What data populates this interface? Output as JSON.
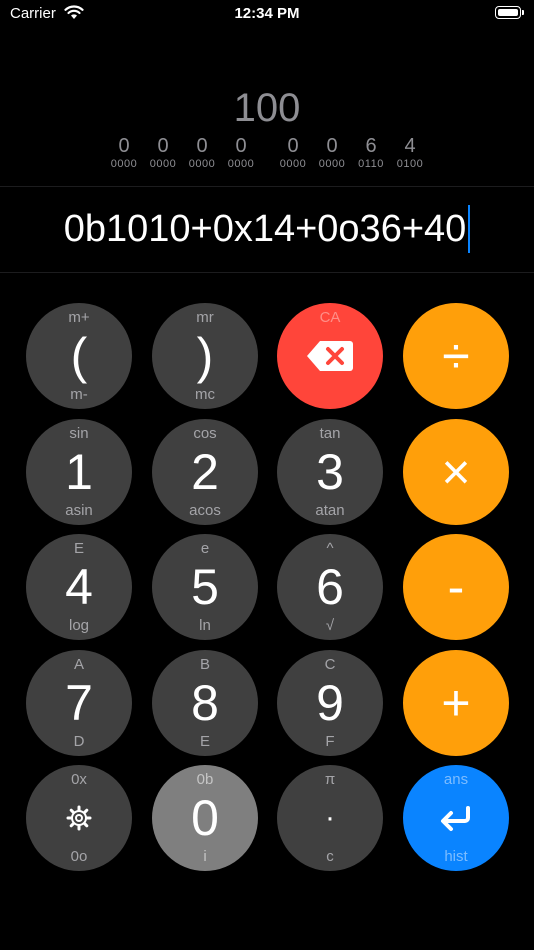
{
  "status": {
    "carrier": "Carrier",
    "time": "12:34 PM"
  },
  "display": {
    "result": "100",
    "nibbles": [
      {
        "hex": "0",
        "bin": "0000"
      },
      {
        "hex": "0",
        "bin": "0000"
      },
      {
        "hex": "0",
        "bin": "0000"
      },
      {
        "hex": "0",
        "bin": "0000"
      },
      {
        "hex": "0",
        "bin": "0000"
      },
      {
        "hex": "0",
        "bin": "0000"
      },
      {
        "hex": "6",
        "bin": "0110"
      },
      {
        "hex": "4",
        "bin": "0100"
      }
    ],
    "expression": "0b1010+0x14+0o36+40"
  },
  "keys": {
    "paren_open": {
      "top": "m+",
      "main": "(",
      "bottom": "m-"
    },
    "paren_close": {
      "top": "mr",
      "main": ")",
      "bottom": "mc"
    },
    "backspace": {
      "top": "CA"
    },
    "divide": {
      "main": "÷"
    },
    "one": {
      "top": "sin",
      "main": "1",
      "bottom": "asin"
    },
    "two": {
      "top": "cos",
      "main": "2",
      "bottom": "acos"
    },
    "three": {
      "top": "tan",
      "main": "3",
      "bottom": "atan"
    },
    "multiply": {
      "main": "×"
    },
    "four": {
      "top": "E",
      "main": "4",
      "bottom": "log"
    },
    "five": {
      "top": "e",
      "main": "5",
      "bottom": "ln"
    },
    "six": {
      "top": "^",
      "main": "6",
      "bottom": "√"
    },
    "minus": {
      "main": "-"
    },
    "seven": {
      "top": "A",
      "main": "7",
      "bottom": "D"
    },
    "eight": {
      "top": "B",
      "main": "8",
      "bottom": "E"
    },
    "nine": {
      "top": "C",
      "main": "9",
      "bottom": "F"
    },
    "plus": {
      "main": "+"
    },
    "settings": {
      "top": "0x",
      "bottom": "0o"
    },
    "zero": {
      "top": "0b",
      "main": "0",
      "bottom": "i"
    },
    "dot": {
      "top": "π",
      "main": "·",
      "bottom": "c"
    },
    "enter": {
      "top": "ans",
      "bottom": "hist"
    }
  },
  "colors": {
    "orange": "#ff9f0a",
    "red": "#ff453a",
    "blue": "#0a84ff",
    "dark": "#404040",
    "cursor": "#0a84ff"
  },
  "icons": {
    "backspace": "backspace-icon",
    "settings": "gear-icon",
    "enter": "return-icon",
    "wifi": "wifi-icon",
    "battery": "battery-icon"
  }
}
